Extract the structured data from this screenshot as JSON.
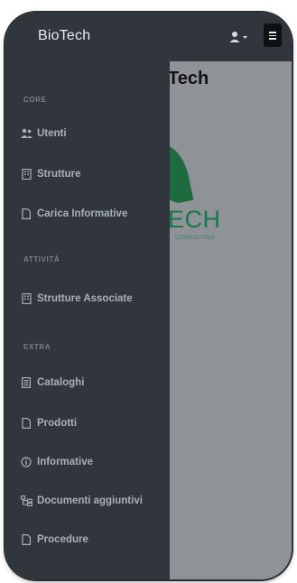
{
  "app": {
    "brand": "BioTech"
  },
  "content": {
    "title_fragment": "Tech",
    "logo_text": "ECH",
    "logo_sub": "CONSULTING"
  },
  "sidebar": {
    "sections": [
      {
        "heading": "CORE"
      },
      {
        "heading": "ATTIVITÀ"
      },
      {
        "heading": "EXTRA"
      }
    ],
    "items": [
      {
        "label": "Utenti",
        "icon": "users-icon"
      },
      {
        "label": "Strutture",
        "icon": "building-icon"
      },
      {
        "label": "Carica Informative",
        "icon": "file-icon"
      },
      {
        "label": "Strutture Associate",
        "icon": "building-icon"
      },
      {
        "label": "Cataloghi",
        "icon": "list-icon"
      },
      {
        "label": "Prodotti",
        "icon": "file-icon"
      },
      {
        "label": "Informative",
        "icon": "info-circle-icon"
      },
      {
        "label": "Documenti aggiuntivi",
        "icon": "folder-tree-icon"
      },
      {
        "label": "Procedure",
        "icon": "file-icon"
      }
    ]
  },
  "colors": {
    "sidebar_bg": "#30363c",
    "overlay_bg": "#8f9398",
    "logo_green": "#17784a",
    "menu_text": "#a9b0b7"
  }
}
